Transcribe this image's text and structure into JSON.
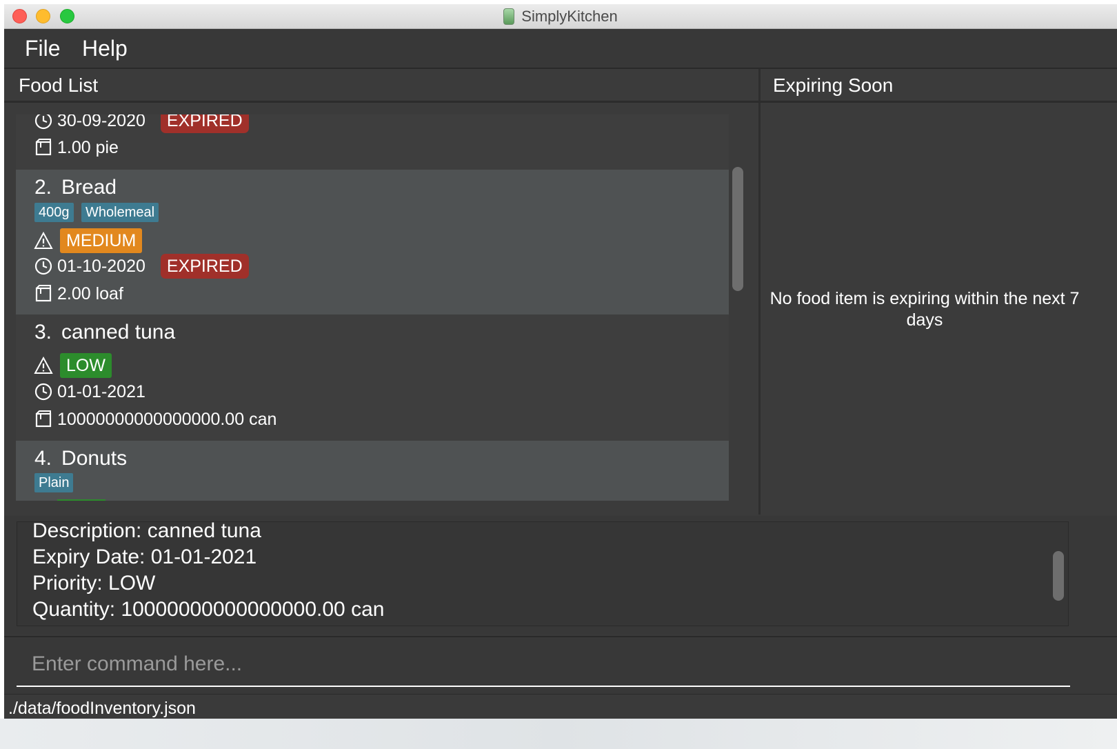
{
  "window": {
    "title": "SimplyKitchen"
  },
  "menu": {
    "file": "File",
    "help": "Help"
  },
  "panels": {
    "food_list": "Food List",
    "expiring_soon": "Expiring Soon"
  },
  "food_items": [
    {
      "expiry": "30-09-2020",
      "expired_label": "EXPIRED",
      "quantity": "1.00 pie"
    },
    {
      "index": "2.",
      "name": "Bread",
      "tags": [
        "400g",
        "Wholemeal"
      ],
      "priority": "MEDIUM",
      "expiry": "01-10-2020",
      "expired_label": "EXPIRED",
      "quantity": "2.00 loaf"
    },
    {
      "index": "3.",
      "name": "canned tuna",
      "priority": "LOW",
      "expiry": "01-01-2021",
      "quantity": "10000000000000000.00 can"
    },
    {
      "index": "4.",
      "name": "Donuts",
      "tags": [
        "Plain"
      ]
    }
  ],
  "expiring": {
    "empty_message": "No food item is expiring within the next 7 days"
  },
  "result": {
    "description": "Description: canned tuna",
    "expiry": "Expiry Date: 01-01-2021",
    "priority": "Priority: LOW",
    "quantity": "Quantity: 10000000000000000.00 can"
  },
  "command": {
    "placeholder": "Enter command here..."
  },
  "status": {
    "file_path": "./data/foodInventory.json"
  },
  "colors": {
    "tag": "#3e7b91",
    "medium": "#e2881e",
    "low": "#2c8c2c",
    "expired": "#a0302a",
    "background": "#3a3a3a",
    "selected_card": "#4f5253"
  },
  "icons": {
    "priority": "warning-icon",
    "expiry": "clock-icon",
    "quantity": "box-icon"
  }
}
